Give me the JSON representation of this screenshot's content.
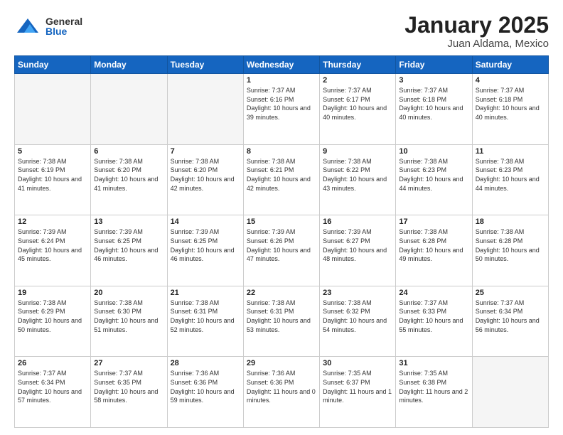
{
  "logo": {
    "general": "General",
    "blue": "Blue"
  },
  "header": {
    "month": "January 2025",
    "location": "Juan Aldama, Mexico"
  },
  "days_of_week": [
    "Sunday",
    "Monday",
    "Tuesday",
    "Wednesday",
    "Thursday",
    "Friday",
    "Saturday"
  ],
  "weeks": [
    [
      {
        "day": "",
        "sunrise": "",
        "sunset": "",
        "daylight": "",
        "empty": true
      },
      {
        "day": "",
        "sunrise": "",
        "sunset": "",
        "daylight": "",
        "empty": true
      },
      {
        "day": "",
        "sunrise": "",
        "sunset": "",
        "daylight": "",
        "empty": true
      },
      {
        "day": "1",
        "sunrise": "Sunrise: 7:37 AM",
        "sunset": "Sunset: 6:16 PM",
        "daylight": "Daylight: 10 hours and 39 minutes."
      },
      {
        "day": "2",
        "sunrise": "Sunrise: 7:37 AM",
        "sunset": "Sunset: 6:17 PM",
        "daylight": "Daylight: 10 hours and 40 minutes."
      },
      {
        "day": "3",
        "sunrise": "Sunrise: 7:37 AM",
        "sunset": "Sunset: 6:18 PM",
        "daylight": "Daylight: 10 hours and 40 minutes."
      },
      {
        "day": "4",
        "sunrise": "Sunrise: 7:37 AM",
        "sunset": "Sunset: 6:18 PM",
        "daylight": "Daylight: 10 hours and 40 minutes."
      }
    ],
    [
      {
        "day": "5",
        "sunrise": "Sunrise: 7:38 AM",
        "sunset": "Sunset: 6:19 PM",
        "daylight": "Daylight: 10 hours and 41 minutes."
      },
      {
        "day": "6",
        "sunrise": "Sunrise: 7:38 AM",
        "sunset": "Sunset: 6:20 PM",
        "daylight": "Daylight: 10 hours and 41 minutes."
      },
      {
        "day": "7",
        "sunrise": "Sunrise: 7:38 AM",
        "sunset": "Sunset: 6:20 PM",
        "daylight": "Daylight: 10 hours and 42 minutes."
      },
      {
        "day": "8",
        "sunrise": "Sunrise: 7:38 AM",
        "sunset": "Sunset: 6:21 PM",
        "daylight": "Daylight: 10 hours and 42 minutes."
      },
      {
        "day": "9",
        "sunrise": "Sunrise: 7:38 AM",
        "sunset": "Sunset: 6:22 PM",
        "daylight": "Daylight: 10 hours and 43 minutes."
      },
      {
        "day": "10",
        "sunrise": "Sunrise: 7:38 AM",
        "sunset": "Sunset: 6:23 PM",
        "daylight": "Daylight: 10 hours and 44 minutes."
      },
      {
        "day": "11",
        "sunrise": "Sunrise: 7:38 AM",
        "sunset": "Sunset: 6:23 PM",
        "daylight": "Daylight: 10 hours and 44 minutes."
      }
    ],
    [
      {
        "day": "12",
        "sunrise": "Sunrise: 7:39 AM",
        "sunset": "Sunset: 6:24 PM",
        "daylight": "Daylight: 10 hours and 45 minutes."
      },
      {
        "day": "13",
        "sunrise": "Sunrise: 7:39 AM",
        "sunset": "Sunset: 6:25 PM",
        "daylight": "Daylight: 10 hours and 46 minutes."
      },
      {
        "day": "14",
        "sunrise": "Sunrise: 7:39 AM",
        "sunset": "Sunset: 6:25 PM",
        "daylight": "Daylight: 10 hours and 46 minutes."
      },
      {
        "day": "15",
        "sunrise": "Sunrise: 7:39 AM",
        "sunset": "Sunset: 6:26 PM",
        "daylight": "Daylight: 10 hours and 47 minutes."
      },
      {
        "day": "16",
        "sunrise": "Sunrise: 7:39 AM",
        "sunset": "Sunset: 6:27 PM",
        "daylight": "Daylight: 10 hours and 48 minutes."
      },
      {
        "day": "17",
        "sunrise": "Sunrise: 7:38 AM",
        "sunset": "Sunset: 6:28 PM",
        "daylight": "Daylight: 10 hours and 49 minutes."
      },
      {
        "day": "18",
        "sunrise": "Sunrise: 7:38 AM",
        "sunset": "Sunset: 6:28 PM",
        "daylight": "Daylight: 10 hours and 50 minutes."
      }
    ],
    [
      {
        "day": "19",
        "sunrise": "Sunrise: 7:38 AM",
        "sunset": "Sunset: 6:29 PM",
        "daylight": "Daylight: 10 hours and 50 minutes."
      },
      {
        "day": "20",
        "sunrise": "Sunrise: 7:38 AM",
        "sunset": "Sunset: 6:30 PM",
        "daylight": "Daylight: 10 hours and 51 minutes."
      },
      {
        "day": "21",
        "sunrise": "Sunrise: 7:38 AM",
        "sunset": "Sunset: 6:31 PM",
        "daylight": "Daylight: 10 hours and 52 minutes."
      },
      {
        "day": "22",
        "sunrise": "Sunrise: 7:38 AM",
        "sunset": "Sunset: 6:31 PM",
        "daylight": "Daylight: 10 hours and 53 minutes."
      },
      {
        "day": "23",
        "sunrise": "Sunrise: 7:38 AM",
        "sunset": "Sunset: 6:32 PM",
        "daylight": "Daylight: 10 hours and 54 minutes."
      },
      {
        "day": "24",
        "sunrise": "Sunrise: 7:37 AM",
        "sunset": "Sunset: 6:33 PM",
        "daylight": "Daylight: 10 hours and 55 minutes."
      },
      {
        "day": "25",
        "sunrise": "Sunrise: 7:37 AM",
        "sunset": "Sunset: 6:34 PM",
        "daylight": "Daylight: 10 hours and 56 minutes."
      }
    ],
    [
      {
        "day": "26",
        "sunrise": "Sunrise: 7:37 AM",
        "sunset": "Sunset: 6:34 PM",
        "daylight": "Daylight: 10 hours and 57 minutes."
      },
      {
        "day": "27",
        "sunrise": "Sunrise: 7:37 AM",
        "sunset": "Sunset: 6:35 PM",
        "daylight": "Daylight: 10 hours and 58 minutes."
      },
      {
        "day": "28",
        "sunrise": "Sunrise: 7:36 AM",
        "sunset": "Sunset: 6:36 PM",
        "daylight": "Daylight: 10 hours and 59 minutes."
      },
      {
        "day": "29",
        "sunrise": "Sunrise: 7:36 AM",
        "sunset": "Sunset: 6:36 PM",
        "daylight": "Daylight: 11 hours and 0 minutes."
      },
      {
        "day": "30",
        "sunrise": "Sunrise: 7:35 AM",
        "sunset": "Sunset: 6:37 PM",
        "daylight": "Daylight: 11 hours and 1 minute."
      },
      {
        "day": "31",
        "sunrise": "Sunrise: 7:35 AM",
        "sunset": "Sunset: 6:38 PM",
        "daylight": "Daylight: 11 hours and 2 minutes."
      },
      {
        "day": "",
        "sunrise": "",
        "sunset": "",
        "daylight": "",
        "empty": true
      }
    ]
  ]
}
